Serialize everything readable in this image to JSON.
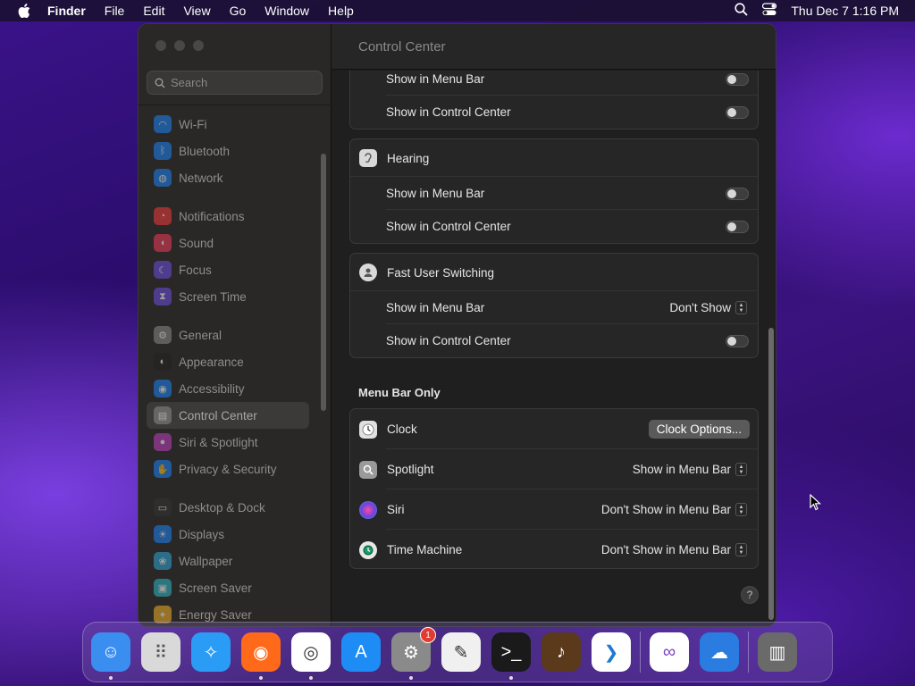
{
  "menubar": {
    "app_name": "Finder",
    "items": [
      "File",
      "Edit",
      "View",
      "Go",
      "Window",
      "Help"
    ],
    "clock": "Thu Dec 7  1:16 PM"
  },
  "sidebar": {
    "search_placeholder": "Search",
    "groups": [
      [
        {
          "label": "Wi-Fi",
          "icon": "wifi-icon",
          "color": "#1a82f7"
        },
        {
          "label": "Bluetooth",
          "icon": "bluetooth-icon",
          "color": "#1a82f7"
        },
        {
          "label": "Network",
          "icon": "globe-icon",
          "color": "#1a82f7"
        }
      ],
      [
        {
          "label": "Notifications",
          "icon": "bell-icon",
          "color": "#f23a3a"
        },
        {
          "label": "Sound",
          "icon": "speaker-icon",
          "color": "#f23a5a"
        },
        {
          "label": "Focus",
          "icon": "moon-icon",
          "color": "#6b4fe0"
        },
        {
          "label": "Screen Time",
          "icon": "hourglass-icon",
          "color": "#6b4fe0"
        }
      ],
      [
        {
          "label": "General",
          "icon": "gear-icon",
          "color": "#8a8a8a"
        },
        {
          "label": "Appearance",
          "icon": "appearance-icon",
          "color": "#222222"
        },
        {
          "label": "Accessibility",
          "icon": "accessibility-icon",
          "color": "#1a82f7"
        },
        {
          "label": "Control Center",
          "icon": "control-center-icon",
          "color": "#8a8a8a",
          "active": true
        },
        {
          "label": "Siri & Spotlight",
          "icon": "siri-icon",
          "color": "#c040c0"
        },
        {
          "label": "Privacy & Security",
          "icon": "hand-icon",
          "color": "#1a82f7"
        }
      ],
      [
        {
          "label": "Desktop & Dock",
          "icon": "dock-icon",
          "color": "#333333"
        },
        {
          "label": "Displays",
          "icon": "sun-icon",
          "color": "#1a82f7"
        },
        {
          "label": "Wallpaper",
          "icon": "wallpaper-icon",
          "color": "#2fa8d8"
        },
        {
          "label": "Screen Saver",
          "icon": "screensaver-icon",
          "color": "#2fb8c8"
        },
        {
          "label": "Energy Saver",
          "icon": "bulb-icon",
          "color": "#f2b027"
        }
      ]
    ]
  },
  "content": {
    "title": "Control Center",
    "top_group": {
      "rows": [
        {
          "label": "Show in Menu Bar",
          "control": "toggle",
          "on": false
        },
        {
          "label": "Show in Control Center",
          "control": "toggle",
          "on": false
        }
      ]
    },
    "hearing": {
      "title": "Hearing",
      "rows": [
        {
          "label": "Show in Menu Bar",
          "control": "toggle",
          "on": false
        },
        {
          "label": "Show in Control Center",
          "control": "toggle",
          "on": false
        }
      ]
    },
    "fast_user": {
      "title": "Fast User Switching",
      "rows": [
        {
          "label": "Show in Menu Bar",
          "control": "popup",
          "value": "Don't Show"
        },
        {
          "label": "Show in Control Center",
          "control": "toggle",
          "on": false
        }
      ]
    },
    "menu_bar_only": {
      "title": "Menu Bar Only",
      "rows": [
        {
          "label": "Clock",
          "control": "button",
          "value": "Clock Options..."
        },
        {
          "label": "Spotlight",
          "control": "popup",
          "value": "Show in Menu Bar"
        },
        {
          "label": "Siri",
          "control": "popup",
          "value": "Don't Show in Menu Bar"
        },
        {
          "label": "Time Machine",
          "control": "popup",
          "value": "Don't Show in Menu Bar"
        }
      ]
    },
    "help_label": "?"
  },
  "dock": {
    "apps": [
      {
        "name": "Finder",
        "color": "#3a8ef0",
        "running": true
      },
      {
        "name": "Launchpad",
        "color": "#d9d9d9",
        "running": false
      },
      {
        "name": "Safari",
        "color": "#2a9cf5",
        "running": false
      },
      {
        "name": "Firefox",
        "color": "#ff6a1a",
        "running": true
      },
      {
        "name": "Chrome",
        "color": "#ffffff",
        "running": true
      },
      {
        "name": "App Store",
        "color": "#1e8cf5",
        "running": false
      },
      {
        "name": "System Settings",
        "color": "#8a8a8a",
        "running": true,
        "badge": "1"
      },
      {
        "name": "TextEdit",
        "color": "#f0f0f0",
        "running": false
      },
      {
        "name": "Terminal",
        "color": "#1a1a1a",
        "running": true
      },
      {
        "name": "GarageBand",
        "color": "#5a3a1a",
        "running": false
      },
      {
        "name": "Visual Studio Code",
        "color": "#ffffff",
        "running": false
      },
      {
        "name": "Visual Studio",
        "color": "#ffffff",
        "running": false
      },
      {
        "name": "Weather",
        "color": "#2a7ce0",
        "running": false
      },
      {
        "name": "Trash",
        "color": "#6a6a6a",
        "running": false
      }
    ]
  }
}
